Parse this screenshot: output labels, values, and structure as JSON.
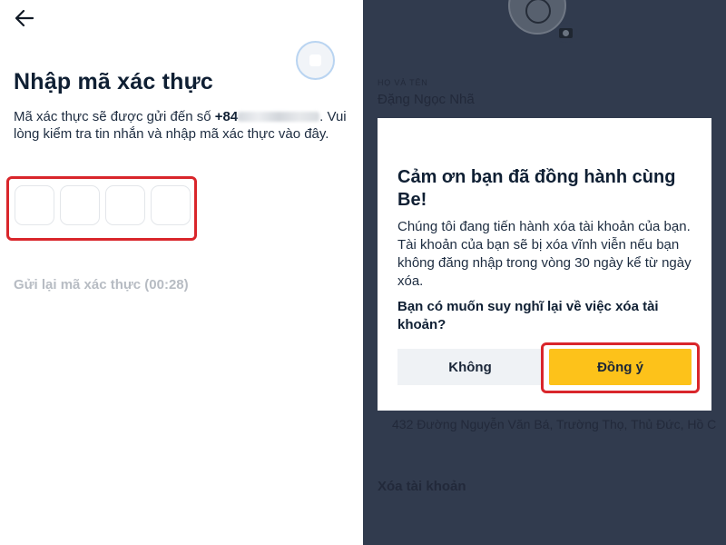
{
  "otp_screen": {
    "back_icon": "arrow-left-icon",
    "title": "Nhập mã xác thực",
    "desc_prefix": "Mã xác thực sẽ được gửi đến số ",
    "phone_prefix": "+84",
    "desc_suffix": ".",
    "desc_line2": "Vui lòng kiểm tra tin nhắn và nhập mã xác thực vào đây.",
    "code_boxes": [
      "",
      "",
      "",
      ""
    ],
    "resend_label": "Gửi lại mã xác thực (00:28)",
    "highlight_color": "#d9262b"
  },
  "profile": {
    "camera_icon": "camera-icon",
    "name_label": "HỌ VÀ TÊN",
    "name_value": "Đặng Ngọc Nhã",
    "address_value": "432 Đường Nguyễn Văn Bá, Trường Thọ, Thủ Đức, Hồ C",
    "delete_account_label": "Xóa tài khoản",
    "background_color": "#313b4e"
  },
  "dialog": {
    "title": "Cảm ơn bạn đã đồng hành cùng Be!",
    "body": "Chúng tôi đang tiến hành xóa tài khoản của bạn. Tài khoản của bạn sẽ bị xóa vĩnh viễn nếu bạn không đăng nhập trong vòng 30 ngày  kể từ ngày xóa.",
    "question": "Bạn có muốn suy nghĩ lại về việc xóa tài khoản?",
    "cancel_label": "Không",
    "confirm_label": "Đồng ý",
    "confirm_color": "#fdc21a"
  }
}
